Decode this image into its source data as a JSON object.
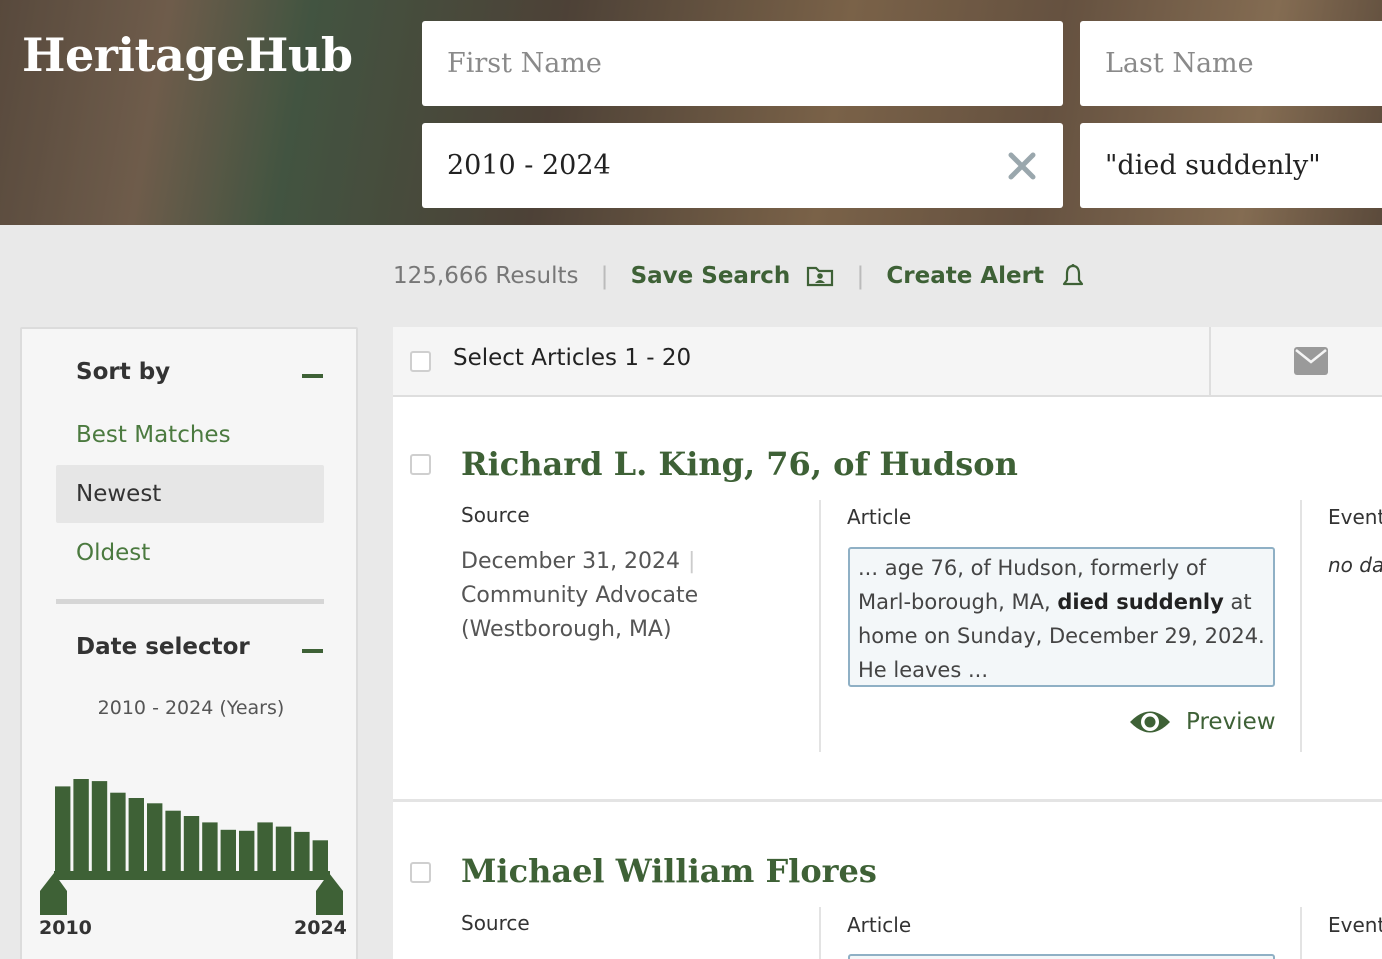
{
  "header": {
    "logo": "HeritageHub",
    "first_name_placeholder": "First Name",
    "last_name_placeholder": "Last Name",
    "date_value": "2010 - 2024",
    "keyword_value": "\"died suddenly\""
  },
  "results_bar": {
    "count": "125,666 Results",
    "save_search": "Save Search",
    "create_alert": "Create Alert"
  },
  "sidebar": {
    "sort_heading": "Sort by",
    "sort_options": [
      "Best Matches",
      "Newest",
      "Oldest"
    ],
    "active_sort": "Newest",
    "date_heading": "Date selector",
    "date_range": "2010 - 2024 (Years)",
    "year_start": "2010",
    "year_end": "2024"
  },
  "chart_data": {
    "type": "bar",
    "x": [
      "2010",
      "2011",
      "2012",
      "2013",
      "2014",
      "2015",
      "2016",
      "2017",
      "2018",
      "2019",
      "2020",
      "2021",
      "2022",
      "2023",
      "2024"
    ],
    "values": [
      80,
      87,
      85,
      74,
      69,
      64,
      57,
      52,
      46,
      39,
      38,
      46,
      42,
      37,
      29
    ],
    "title": "",
    "xlabel": "",
    "ylabel": ""
  },
  "main": {
    "select_label": "Select Articles 1 - 20",
    "records": [
      {
        "title": "Richard L. King, 76, of Hudson",
        "source_heading": "Source",
        "source_date": "December 31, 2024",
        "source_name": "Community Advocate",
        "source_place": "(Westborough, MA)",
        "article_heading": "Article",
        "snippet_pre": "... age 76, of Hudson, formerly of Marl-borough, MA, ",
        "snippet_bold": "died suddenly",
        "snippet_post": " at home on Sunday, December 29, 2024. He leaves ...",
        "preview_label": "Preview",
        "event_heading": "Event",
        "event_value": "no da"
      },
      {
        "title": "Michael William Flores",
        "source_heading": "Source",
        "article_heading": "Article",
        "event_heading": "Event"
      }
    ]
  }
}
